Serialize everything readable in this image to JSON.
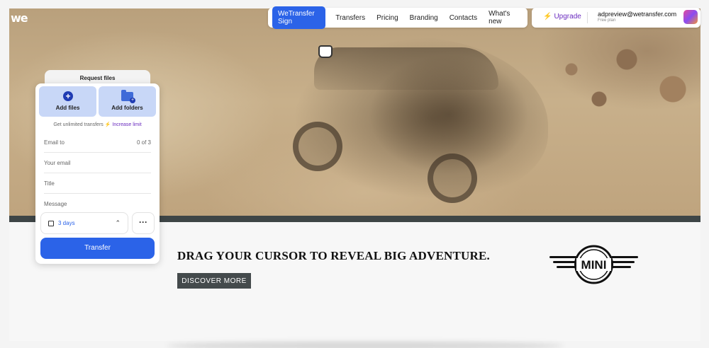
{
  "brand": {
    "logo_text": "we"
  },
  "nav": {
    "sign_label": "WeTransfer Sign",
    "links": [
      "Transfers",
      "Pricing",
      "Branding",
      "Contacts",
      "What's new"
    ]
  },
  "account": {
    "upgrade_label": "Upgrade",
    "email": "adpreview@wetransfer.com",
    "plan": "Free plan"
  },
  "upload": {
    "request_tab": "Request files",
    "add_files": "Add files",
    "add_folders": "Add folders",
    "limit_text": "Get unlimited transfers",
    "limit_link": "Increase limit",
    "email_to_label": "Email to",
    "email_count": "0 of 3",
    "your_email": "Your email",
    "title": "Title",
    "message": "Message",
    "expiry": "3 days",
    "transfer_label": "Transfer"
  },
  "ad": {
    "headline": "DRAG YOUR CURSOR TO REVEAL BIG ADVENTURE.",
    "cta": "DISCOVER MORE",
    "logo_text": "MINI"
  },
  "colors": {
    "accent": "#2b63e8",
    "upgrade": "#6a2bbf"
  }
}
